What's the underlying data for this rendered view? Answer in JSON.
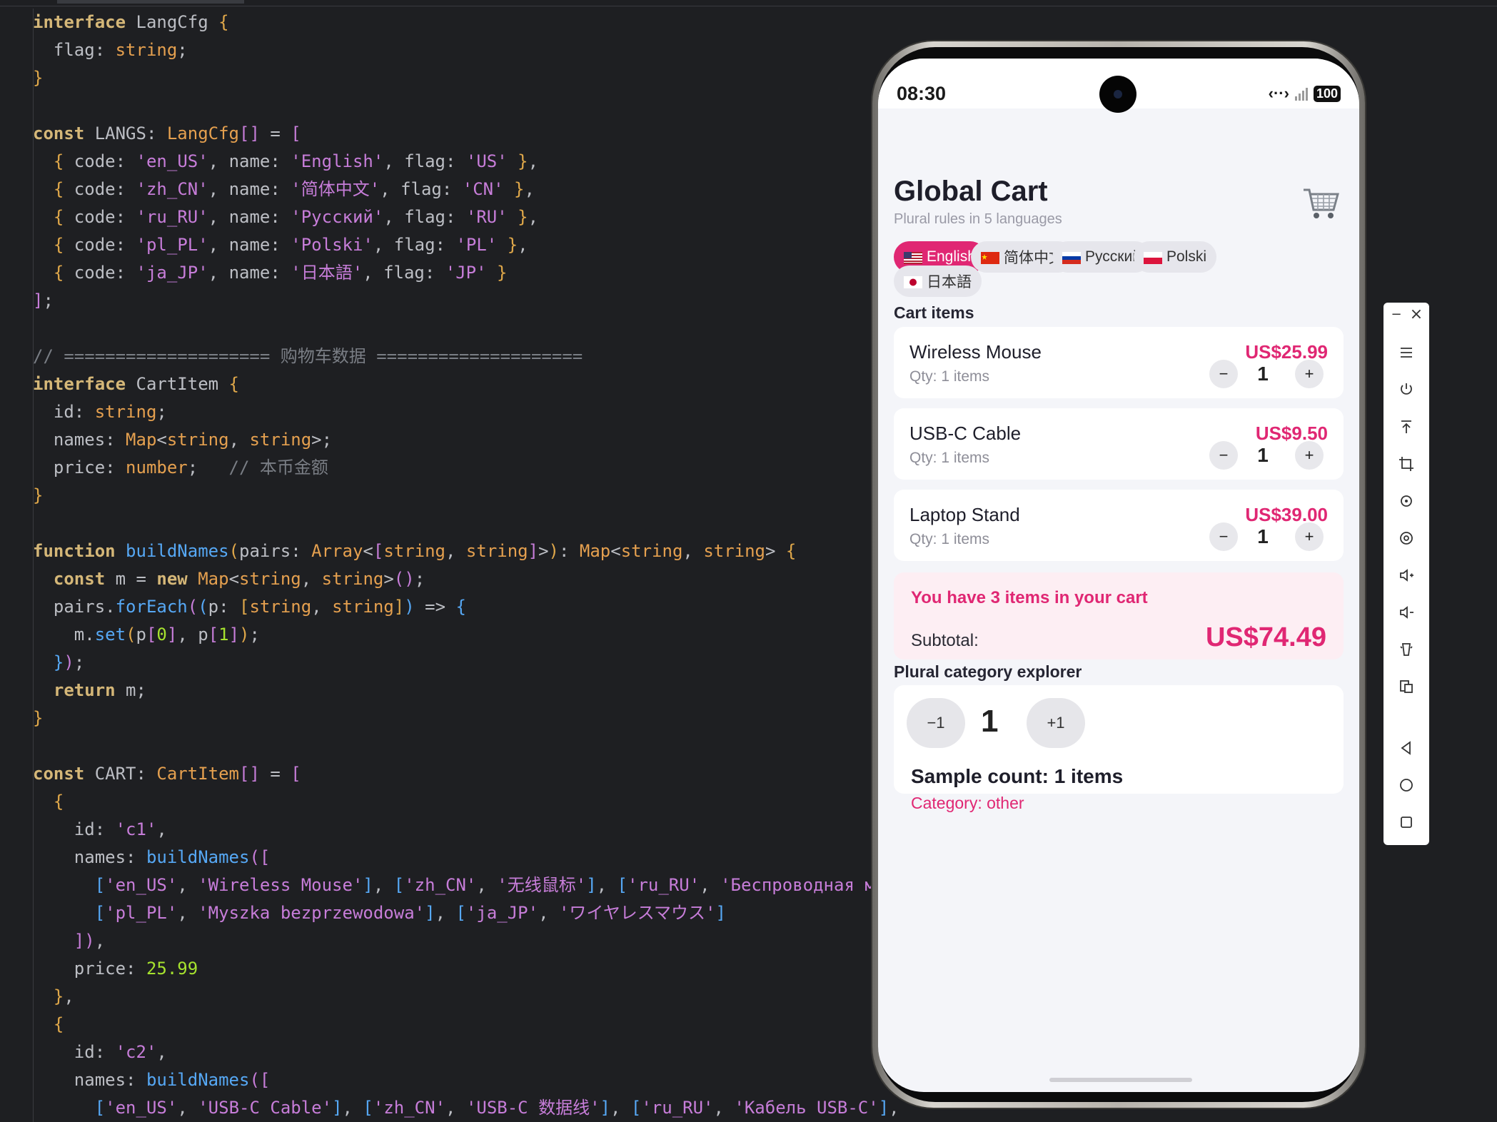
{
  "editor": {
    "lines": [
      [
        [
          "k",
          "interface"
        ],
        [
          "id",
          " LangCfg "
        ],
        [
          "b1",
          "{"
        ]
      ],
      [
        [
          "id",
          "  flag: "
        ],
        [
          "t",
          "string"
        ],
        [
          "id",
          ";"
        ]
      ],
      [
        [
          "b1",
          "}"
        ]
      ],
      [
        [
          "id",
          ""
        ]
      ],
      [
        [
          "k",
          "const"
        ],
        [
          "id",
          " LANGS: "
        ],
        [
          "t",
          "LangCfg"
        ],
        [
          "b2",
          "[]"
        ],
        [
          "id",
          " = "
        ],
        [
          "b2",
          "["
        ]
      ],
      [
        [
          "id",
          "  "
        ],
        [
          "b1",
          "{"
        ],
        [
          "id",
          " code: "
        ],
        [
          "s",
          "'en_US'"
        ],
        [
          "id",
          ", name: "
        ],
        [
          "s",
          "'English'"
        ],
        [
          "id",
          ", flag: "
        ],
        [
          "s",
          "'US'"
        ],
        [
          "id",
          " "
        ],
        [
          "b1",
          "}"
        ],
        [
          "id",
          ","
        ]
      ],
      [
        [
          "id",
          "  "
        ],
        [
          "b1",
          "{"
        ],
        [
          "id",
          " code: "
        ],
        [
          "s",
          "'zh_CN'"
        ],
        [
          "id",
          ", name: "
        ],
        [
          "s",
          "'简体中文'"
        ],
        [
          "id",
          ", flag: "
        ],
        [
          "s",
          "'CN'"
        ],
        [
          "id",
          " "
        ],
        [
          "b1",
          "}"
        ],
        [
          "id",
          ","
        ]
      ],
      [
        [
          "id",
          "  "
        ],
        [
          "b1",
          "{"
        ],
        [
          "id",
          " code: "
        ],
        [
          "s",
          "'ru_RU'"
        ],
        [
          "id",
          ", name: "
        ],
        [
          "s",
          "'Русский'"
        ],
        [
          "id",
          ", flag: "
        ],
        [
          "s",
          "'RU'"
        ],
        [
          "id",
          " "
        ],
        [
          "b1",
          "}"
        ],
        [
          "id",
          ","
        ]
      ],
      [
        [
          "id",
          "  "
        ],
        [
          "b1",
          "{"
        ],
        [
          "id",
          " code: "
        ],
        [
          "s",
          "'pl_PL'"
        ],
        [
          "id",
          ", name: "
        ],
        [
          "s",
          "'Polski'"
        ],
        [
          "id",
          ", flag: "
        ],
        [
          "s",
          "'PL'"
        ],
        [
          "id",
          " "
        ],
        [
          "b1",
          "}"
        ],
        [
          "id",
          ","
        ]
      ],
      [
        [
          "id",
          "  "
        ],
        [
          "b1",
          "{"
        ],
        [
          "id",
          " code: "
        ],
        [
          "s",
          "'ja_JP'"
        ],
        [
          "id",
          ", name: "
        ],
        [
          "s",
          "'日本語'"
        ],
        [
          "id",
          ", flag: "
        ],
        [
          "s",
          "'JP'"
        ],
        [
          "id",
          " "
        ],
        [
          "b1",
          "}"
        ]
      ],
      [
        [
          "b2",
          "]"
        ],
        [
          "id",
          ";"
        ]
      ],
      [
        [
          "id",
          ""
        ]
      ],
      [
        [
          "c",
          "// ==================== 购物车数据 ===================="
        ]
      ],
      [
        [
          "k",
          "interface"
        ],
        [
          "id",
          " CartItem "
        ],
        [
          "b1",
          "{"
        ]
      ],
      [
        [
          "id",
          "  id: "
        ],
        [
          "t",
          "string"
        ],
        [
          "id",
          ";"
        ]
      ],
      [
        [
          "id",
          "  names: "
        ],
        [
          "t",
          "Map"
        ],
        [
          "id",
          "<"
        ],
        [
          "t",
          "string"
        ],
        [
          "id",
          ", "
        ],
        [
          "t",
          "string"
        ],
        [
          "id",
          ">;"
        ]
      ],
      [
        [
          "id",
          "  price: "
        ],
        [
          "t",
          "number"
        ],
        [
          "id",
          ";   "
        ],
        [
          "c",
          "// 本币金额"
        ]
      ],
      [
        [
          "b1",
          "}"
        ]
      ],
      [
        [
          "id",
          ""
        ]
      ],
      [
        [
          "k",
          "function"
        ],
        [
          "id",
          " "
        ],
        [
          "f",
          "buildNames"
        ],
        [
          "b1",
          "("
        ],
        [
          "id",
          "pairs: "
        ],
        [
          "t",
          "Array"
        ],
        [
          "id",
          "<"
        ],
        [
          "b2",
          "["
        ],
        [
          "t",
          "string"
        ],
        [
          "id",
          ", "
        ],
        [
          "t",
          "string"
        ],
        [
          "b2",
          "]"
        ],
        [
          "id",
          ">"
        ],
        [
          "b1",
          ")"
        ],
        [
          "id",
          ": "
        ],
        [
          "t",
          "Map"
        ],
        [
          "id",
          "<"
        ],
        [
          "t",
          "string"
        ],
        [
          "id",
          ", "
        ],
        [
          "t",
          "string"
        ],
        [
          "id",
          "> "
        ],
        [
          "b1",
          "{"
        ]
      ],
      [
        [
          "id",
          "  "
        ],
        [
          "k",
          "const"
        ],
        [
          "id",
          " m = "
        ],
        [
          "k",
          "new"
        ],
        [
          "id",
          " "
        ],
        [
          "t",
          "Map"
        ],
        [
          "id",
          "<"
        ],
        [
          "t",
          "string"
        ],
        [
          "id",
          ", "
        ],
        [
          "t",
          "string"
        ],
        [
          "id",
          ">"
        ],
        [
          "b2",
          "()"
        ],
        [
          "id",
          ";"
        ]
      ],
      [
        [
          "id",
          "  pairs."
        ],
        [
          "f",
          "forEach"
        ],
        [
          "b2",
          "("
        ],
        [
          "b3",
          "("
        ],
        [
          "id",
          "p: "
        ],
        [
          "b1",
          "["
        ],
        [
          "t",
          "string"
        ],
        [
          "id",
          ", "
        ],
        [
          "t",
          "string"
        ],
        [
          "b1",
          "]"
        ],
        [
          "b3",
          ")"
        ],
        [
          "id",
          " => "
        ],
        [
          "b3",
          "{"
        ]
      ],
      [
        [
          "id",
          "    m."
        ],
        [
          "f",
          "set"
        ],
        [
          "b1",
          "("
        ],
        [
          "id",
          "p"
        ],
        [
          "b2",
          "["
        ],
        [
          "n",
          "0"
        ],
        [
          "b2",
          "]"
        ],
        [
          "id",
          ", p"
        ],
        [
          "b2",
          "["
        ],
        [
          "n",
          "1"
        ],
        [
          "b2",
          "]"
        ],
        [
          "b1",
          ")"
        ],
        [
          "id",
          ";"
        ]
      ],
      [
        [
          "id",
          "  "
        ],
        [
          "b3",
          "}"
        ],
        [
          "b2",
          ")"
        ],
        [
          "id",
          ";"
        ]
      ],
      [
        [
          "id",
          "  "
        ],
        [
          "k",
          "return"
        ],
        [
          "id",
          " m;"
        ]
      ],
      [
        [
          "b1",
          "}"
        ]
      ],
      [
        [
          "id",
          ""
        ]
      ],
      [
        [
          "k",
          "const"
        ],
        [
          "id",
          " CART: "
        ],
        [
          "t",
          "CartItem"
        ],
        [
          "b2",
          "[]"
        ],
        [
          "id",
          " = "
        ],
        [
          "b2",
          "["
        ]
      ],
      [
        [
          "id",
          "  "
        ],
        [
          "b1",
          "{"
        ]
      ],
      [
        [
          "id",
          "    id: "
        ],
        [
          "s",
          "'c1'"
        ],
        [
          "id",
          ","
        ]
      ],
      [
        [
          "id",
          "    names: "
        ],
        [
          "f",
          "buildNames"
        ],
        [
          "b2",
          "(["
        ]
      ],
      [
        [
          "id",
          "      "
        ],
        [
          "b3",
          "["
        ],
        [
          "s",
          "'en_US'"
        ],
        [
          "id",
          ", "
        ],
        [
          "s",
          "'Wireless Mouse'"
        ],
        [
          "b3",
          "]"
        ],
        [
          "id",
          ", "
        ],
        [
          "b3",
          "["
        ],
        [
          "s",
          "'zh_CN'"
        ],
        [
          "id",
          ", "
        ],
        [
          "s",
          "'无线鼠标'"
        ],
        [
          "b3",
          "]"
        ],
        [
          "id",
          ", "
        ],
        [
          "b3",
          "["
        ],
        [
          "s",
          "'ru_RU'"
        ],
        [
          "id",
          ", "
        ],
        [
          "s",
          "'Беспроводная мышь'"
        ]
      ],
      [
        [
          "id",
          "      "
        ],
        [
          "b3",
          "["
        ],
        [
          "s",
          "'pl_PL'"
        ],
        [
          "id",
          ", "
        ],
        [
          "s",
          "'Myszka bezprzewodowa'"
        ],
        [
          "b3",
          "]"
        ],
        [
          "id",
          ", "
        ],
        [
          "b3",
          "["
        ],
        [
          "s",
          "'ja_JP'"
        ],
        [
          "id",
          ", "
        ],
        [
          "s",
          "'ワイヤレスマウス'"
        ],
        [
          "b3",
          "]"
        ]
      ],
      [
        [
          "id",
          "    "
        ],
        [
          "b2",
          "])"
        ],
        [
          "id",
          ","
        ]
      ],
      [
        [
          "id",
          "    price: "
        ],
        [
          "n",
          "25.99"
        ]
      ],
      [
        [
          "id",
          "  "
        ],
        [
          "b1",
          "}"
        ],
        [
          "id",
          ","
        ]
      ],
      [
        [
          "id",
          "  "
        ],
        [
          "b1",
          "{"
        ]
      ],
      [
        [
          "id",
          "    id: "
        ],
        [
          "s",
          "'c2'"
        ],
        [
          "id",
          ","
        ]
      ],
      [
        [
          "id",
          "    names: "
        ],
        [
          "f",
          "buildNames"
        ],
        [
          "b2",
          "(["
        ]
      ],
      [
        [
          "id",
          "      "
        ],
        [
          "b3",
          "["
        ],
        [
          "s",
          "'en_US'"
        ],
        [
          "id",
          ", "
        ],
        [
          "s",
          "'USB-C Cable'"
        ],
        [
          "b3",
          "]"
        ],
        [
          "id",
          ", "
        ],
        [
          "b3",
          "["
        ],
        [
          "s",
          "'zh_CN'"
        ],
        [
          "id",
          ", "
        ],
        [
          "s",
          "'USB-C 数据线'"
        ],
        [
          "b3",
          "]"
        ],
        [
          "id",
          ", "
        ],
        [
          "b3",
          "["
        ],
        [
          "s",
          "'ru_RU'"
        ],
        [
          "id",
          ", "
        ],
        [
          "s",
          "'Кабель USB-C'"
        ],
        [
          "b3",
          "]"
        ],
        [
          "id",
          ","
        ]
      ]
    ]
  },
  "status": {
    "time": "08:30",
    "battery": "100",
    "data_icon": "data-transfer-icon",
    "signal_icon": "signal-icon"
  },
  "app": {
    "title": "Global Cart",
    "subtitle": "Plural rules in 5 languages",
    "cart_icon": "shopping-cart-icon",
    "languages": [
      {
        "label": "English",
        "flag": "US",
        "active": true
      },
      {
        "label": "简体中文",
        "flag": "CN",
        "active": false
      },
      {
        "label": "Русский",
        "flag": "RU",
        "active": false
      },
      {
        "label": "Polski",
        "flag": "PL",
        "active": false
      },
      {
        "label": "日本語",
        "flag": "JP",
        "active": false
      }
    ],
    "cart_heading": "Cart items",
    "items": [
      {
        "name": "Wireless Mouse",
        "price": "US$25.99",
        "qty_text": "Qty: 1 items",
        "qty": "1",
        "minus": "−",
        "plus": "+"
      },
      {
        "name": "USB-C Cable",
        "price": "US$9.50",
        "qty_text": "Qty: 1 items",
        "qty": "1",
        "minus": "−",
        "plus": "+"
      },
      {
        "name": "Laptop Stand",
        "price": "US$39.00",
        "qty_text": "Qty: 1 items",
        "qty": "1",
        "minus": "−",
        "plus": "+"
      }
    ],
    "summary": {
      "line": "You have 3 items in your cart",
      "subtotal_label": "Subtotal:",
      "subtotal_value": "US$74.49"
    },
    "explorer": {
      "heading": "Plural category explorer",
      "minus_label": "−1",
      "value": "1",
      "plus_label": "+1",
      "sample": "Sample count: 1 items",
      "category": "Category: other"
    }
  },
  "toolbar": {
    "minimize": "−",
    "close": "×",
    "buttons": [
      "menu-icon",
      "power-icon",
      "pin-top-icon",
      "crop-icon",
      "rotate-icon",
      "screenshot-icon",
      "volume-up-icon",
      "volume-down-icon",
      "shake-icon",
      "multi-screen-icon",
      "back-icon",
      "home-icon",
      "recents-icon"
    ]
  }
}
